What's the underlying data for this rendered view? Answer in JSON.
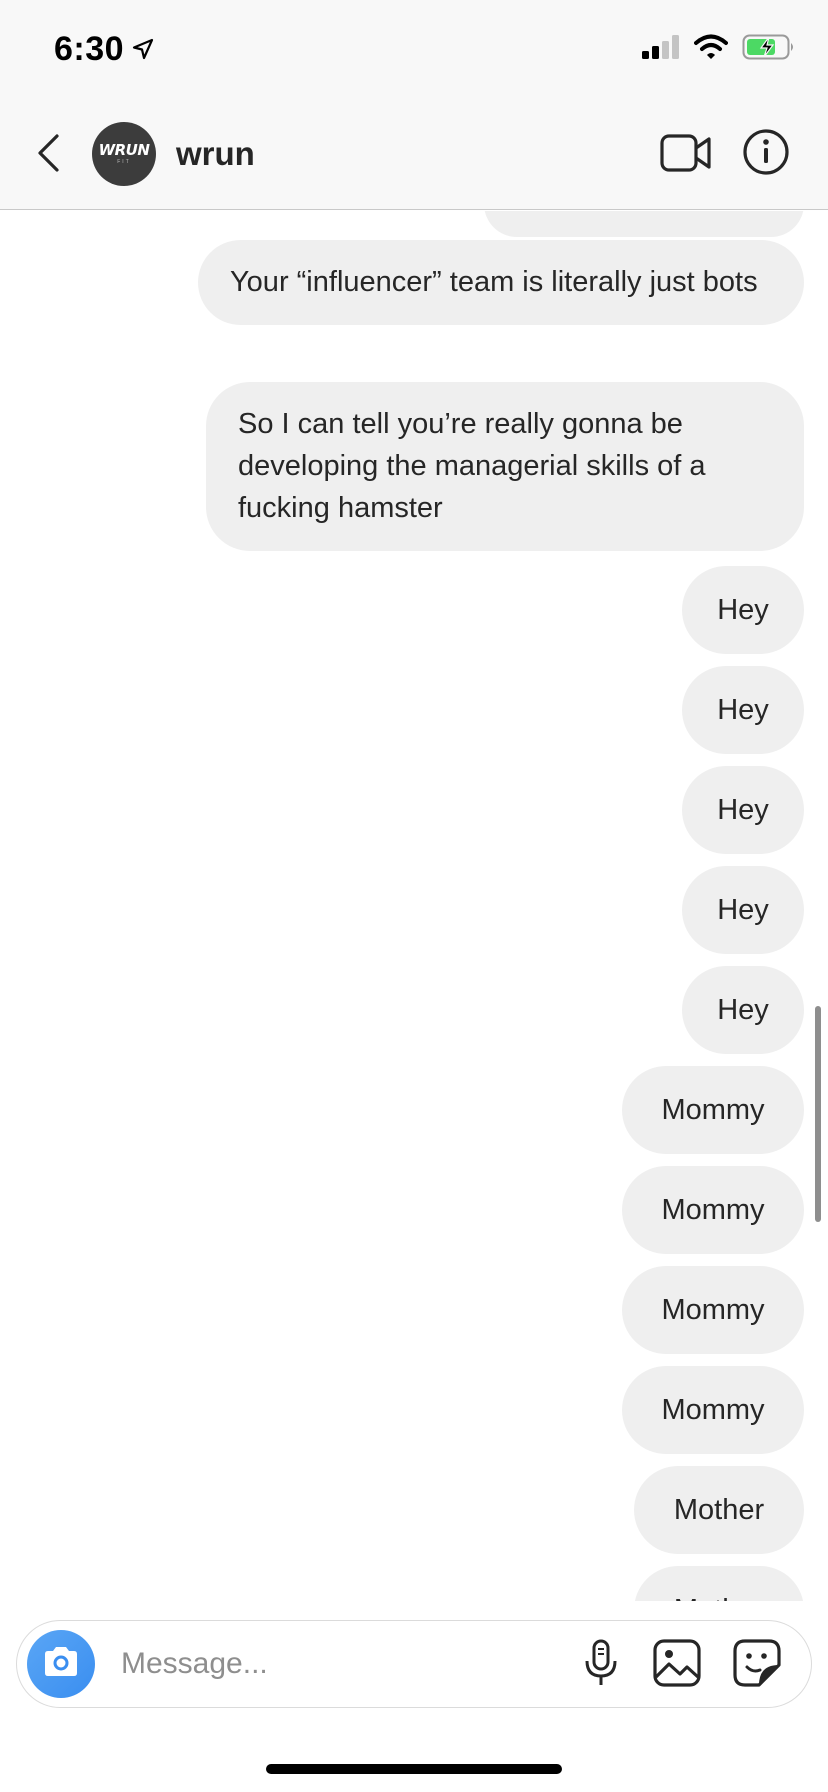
{
  "status_bar": {
    "time": "6:30",
    "location_icon": "location-arrow-icon",
    "signal_icon": "cellular-signal-icon",
    "wifi_icon": "wifi-icon",
    "battery_icon": "battery-charging-icon",
    "battery_color": "#4cd964"
  },
  "header": {
    "back_icon": "chevron-left-icon",
    "avatar_text": "WRUN",
    "avatar_subtext": "FIT",
    "username": "wrun",
    "video_icon": "video-call-icon",
    "info_icon": "info-icon"
  },
  "messages": [
    {
      "text": "Your “influencer” team is literally just bots"
    },
    {
      "text": "So I can tell you’re really gonna be developing the managerial skills of a fucking hamster"
    },
    {
      "text": "Hey"
    },
    {
      "text": "Hey"
    },
    {
      "text": "Hey"
    },
    {
      "text": "Hey"
    },
    {
      "text": "Hey"
    },
    {
      "text": "Mommy"
    },
    {
      "text": "Mommy"
    },
    {
      "text": "Mommy"
    },
    {
      "text": "Mommy"
    },
    {
      "text": "Mother"
    },
    {
      "text": "Mother"
    }
  ],
  "composer": {
    "camera_icon": "camera-icon",
    "placeholder": "Message...",
    "mic_icon": "microphone-icon",
    "gallery_icon": "gallery-icon",
    "sticker_icon": "sticker-icon"
  },
  "colors": {
    "bubble_bg": "#efefef",
    "text": "#262626",
    "camera_button": "#3a8ef0"
  }
}
